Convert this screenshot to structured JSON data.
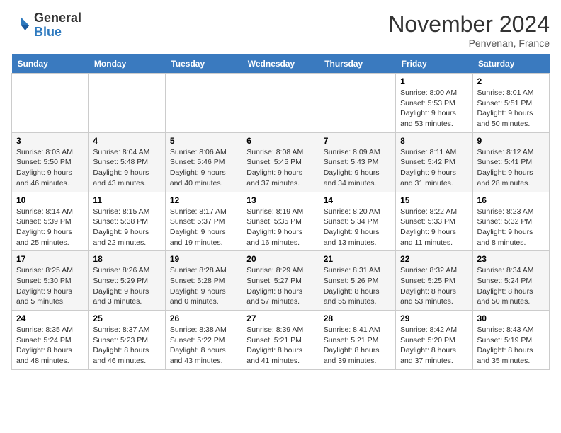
{
  "header": {
    "logo_general": "General",
    "logo_blue": "Blue",
    "month_title": "November 2024",
    "location": "Penvenan, France"
  },
  "days_of_week": [
    "Sunday",
    "Monday",
    "Tuesday",
    "Wednesday",
    "Thursday",
    "Friday",
    "Saturday"
  ],
  "weeks": [
    [
      {
        "day": "",
        "info": ""
      },
      {
        "day": "",
        "info": ""
      },
      {
        "day": "",
        "info": ""
      },
      {
        "day": "",
        "info": ""
      },
      {
        "day": "",
        "info": ""
      },
      {
        "day": "1",
        "info": "Sunrise: 8:00 AM\nSunset: 5:53 PM\nDaylight: 9 hours\nand 53 minutes."
      },
      {
        "day": "2",
        "info": "Sunrise: 8:01 AM\nSunset: 5:51 PM\nDaylight: 9 hours\nand 50 minutes."
      }
    ],
    [
      {
        "day": "3",
        "info": "Sunrise: 8:03 AM\nSunset: 5:50 PM\nDaylight: 9 hours\nand 46 minutes."
      },
      {
        "day": "4",
        "info": "Sunrise: 8:04 AM\nSunset: 5:48 PM\nDaylight: 9 hours\nand 43 minutes."
      },
      {
        "day": "5",
        "info": "Sunrise: 8:06 AM\nSunset: 5:46 PM\nDaylight: 9 hours\nand 40 minutes."
      },
      {
        "day": "6",
        "info": "Sunrise: 8:08 AM\nSunset: 5:45 PM\nDaylight: 9 hours\nand 37 minutes."
      },
      {
        "day": "7",
        "info": "Sunrise: 8:09 AM\nSunset: 5:43 PM\nDaylight: 9 hours\nand 34 minutes."
      },
      {
        "day": "8",
        "info": "Sunrise: 8:11 AM\nSunset: 5:42 PM\nDaylight: 9 hours\nand 31 minutes."
      },
      {
        "day": "9",
        "info": "Sunrise: 8:12 AM\nSunset: 5:41 PM\nDaylight: 9 hours\nand 28 minutes."
      }
    ],
    [
      {
        "day": "10",
        "info": "Sunrise: 8:14 AM\nSunset: 5:39 PM\nDaylight: 9 hours\nand 25 minutes."
      },
      {
        "day": "11",
        "info": "Sunrise: 8:15 AM\nSunset: 5:38 PM\nDaylight: 9 hours\nand 22 minutes."
      },
      {
        "day": "12",
        "info": "Sunrise: 8:17 AM\nSunset: 5:37 PM\nDaylight: 9 hours\nand 19 minutes."
      },
      {
        "day": "13",
        "info": "Sunrise: 8:19 AM\nSunset: 5:35 PM\nDaylight: 9 hours\nand 16 minutes."
      },
      {
        "day": "14",
        "info": "Sunrise: 8:20 AM\nSunset: 5:34 PM\nDaylight: 9 hours\nand 13 minutes."
      },
      {
        "day": "15",
        "info": "Sunrise: 8:22 AM\nSunset: 5:33 PM\nDaylight: 9 hours\nand 11 minutes."
      },
      {
        "day": "16",
        "info": "Sunrise: 8:23 AM\nSunset: 5:32 PM\nDaylight: 9 hours\nand 8 minutes."
      }
    ],
    [
      {
        "day": "17",
        "info": "Sunrise: 8:25 AM\nSunset: 5:30 PM\nDaylight: 9 hours\nand 5 minutes."
      },
      {
        "day": "18",
        "info": "Sunrise: 8:26 AM\nSunset: 5:29 PM\nDaylight: 9 hours\nand 3 minutes."
      },
      {
        "day": "19",
        "info": "Sunrise: 8:28 AM\nSunset: 5:28 PM\nDaylight: 9 hours\nand 0 minutes."
      },
      {
        "day": "20",
        "info": "Sunrise: 8:29 AM\nSunset: 5:27 PM\nDaylight: 8 hours\nand 57 minutes."
      },
      {
        "day": "21",
        "info": "Sunrise: 8:31 AM\nSunset: 5:26 PM\nDaylight: 8 hours\nand 55 minutes."
      },
      {
        "day": "22",
        "info": "Sunrise: 8:32 AM\nSunset: 5:25 PM\nDaylight: 8 hours\nand 53 minutes."
      },
      {
        "day": "23",
        "info": "Sunrise: 8:34 AM\nSunset: 5:24 PM\nDaylight: 8 hours\nand 50 minutes."
      }
    ],
    [
      {
        "day": "24",
        "info": "Sunrise: 8:35 AM\nSunset: 5:24 PM\nDaylight: 8 hours\nand 48 minutes."
      },
      {
        "day": "25",
        "info": "Sunrise: 8:37 AM\nSunset: 5:23 PM\nDaylight: 8 hours\nand 46 minutes."
      },
      {
        "day": "26",
        "info": "Sunrise: 8:38 AM\nSunset: 5:22 PM\nDaylight: 8 hours\nand 43 minutes."
      },
      {
        "day": "27",
        "info": "Sunrise: 8:39 AM\nSunset: 5:21 PM\nDaylight: 8 hours\nand 41 minutes."
      },
      {
        "day": "28",
        "info": "Sunrise: 8:41 AM\nSunset: 5:21 PM\nDaylight: 8 hours\nand 39 minutes."
      },
      {
        "day": "29",
        "info": "Sunrise: 8:42 AM\nSunset: 5:20 PM\nDaylight: 8 hours\nand 37 minutes."
      },
      {
        "day": "30",
        "info": "Sunrise: 8:43 AM\nSunset: 5:19 PM\nDaylight: 8 hours\nand 35 minutes."
      }
    ]
  ]
}
